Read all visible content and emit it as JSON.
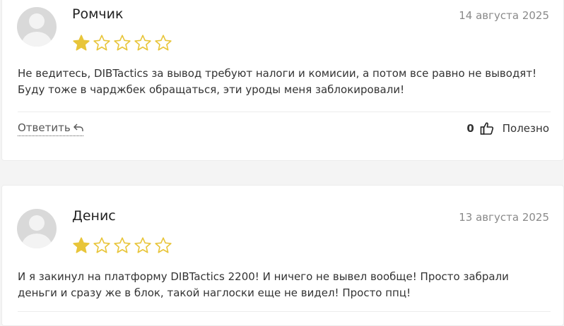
{
  "colors": {
    "star_filled": "#e8c53a",
    "star_empty": "#e8c53a"
  },
  "reviews": [
    {
      "author": "Ромчик",
      "date": "14 августа 2025",
      "rating": 1,
      "max_rating": 5,
      "text_lines": [
        "Не ведитесь, DIBTactics за вывод требуют налоги и комисии, а потом все равно не выводят!",
        "Буду тоже в чарджбек обращаться, эти уроды меня заблокировали!"
      ],
      "reply_label": "Ответить",
      "likes": "0",
      "useful_label": "Полезно"
    },
    {
      "author": "Денис",
      "date": "13 августа 2025",
      "rating": 1,
      "max_rating": 5,
      "text_lines": [
        "И я закинул на платформу DIBTactics 2200! И ничего не вывел вообще! Просто забрали",
        "деньги и сразу же в блок, такой наглоски еще не видел! Просто ппц!"
      ]
    }
  ]
}
